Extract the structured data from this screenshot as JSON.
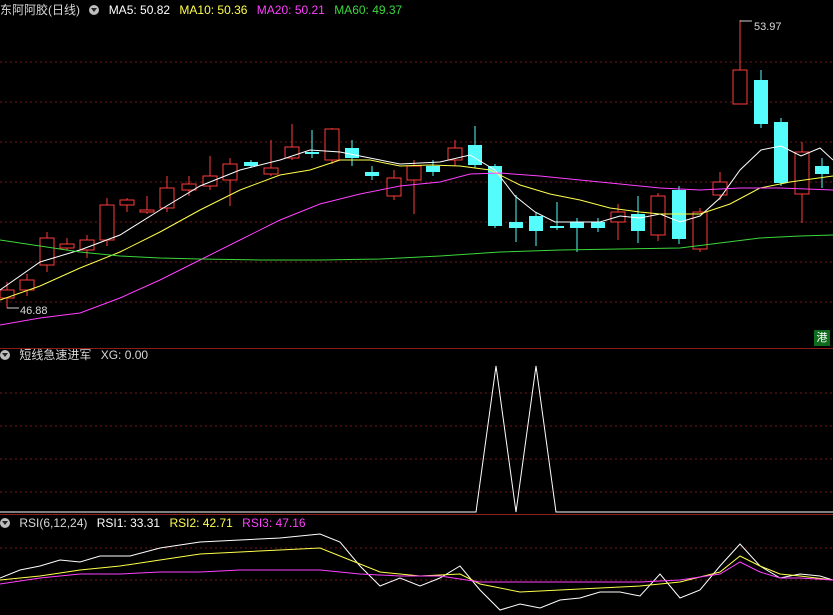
{
  "main": {
    "stock_name": "东阿阿胶(日线)",
    "ma5_label": "MA5: 50.82",
    "ma10_label": "MA10: 50.36",
    "ma20_label": "MA20: 50.21",
    "ma60_label": "MA60: 49.37",
    "high_label": "53.97",
    "low_label": "46.88",
    "badge": "港",
    "colors": {
      "up": "#ff3c3c",
      "down": "#54fcfc",
      "ma5": "#ffffff",
      "ma10": "#ffff4c",
      "ma20": "#ff40ff",
      "ma60": "#3cd83c"
    }
  },
  "indicator": {
    "title": "短线急速进军",
    "xg_label": "XG: 0.00"
  },
  "rsi": {
    "title": "RSI(6,12,24)",
    "rsi1_label": "RSI1: 33.31",
    "rsi2_label": "RSI2: 42.71",
    "rsi3_label": "RSI3: 47.16"
  }
}
